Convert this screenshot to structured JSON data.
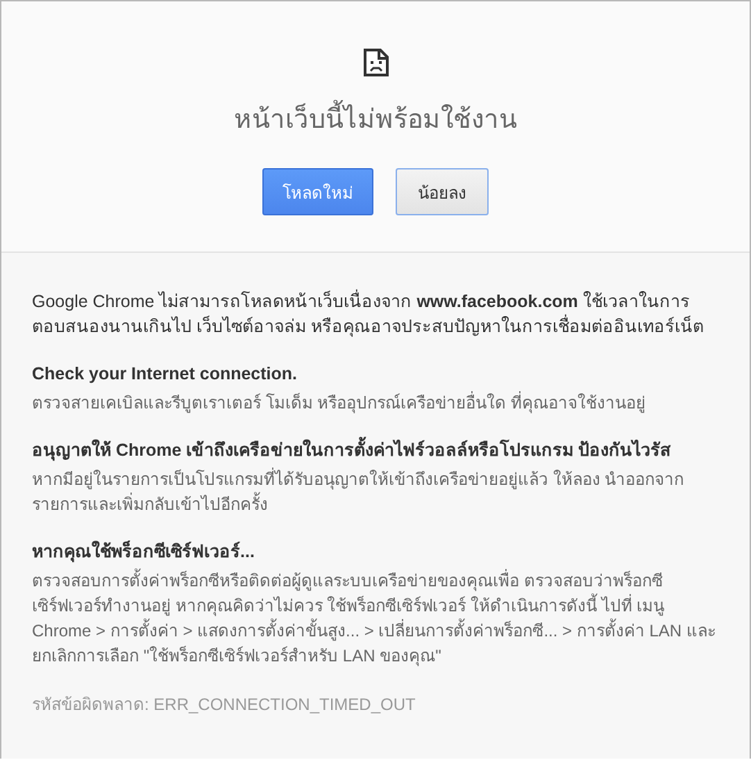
{
  "title": "หน้าเว็บนี้ไม่พร้อมใช้งาน",
  "buttons": [
    {
      "label": "โหลดใหม่",
      "kind": "primary"
    },
    {
      "label": "น้อยลง",
      "kind": "secondary"
    }
  ],
  "summary": "Google Chrome ไม่สามารถโหลดหน้าเว็บเนื่องจาก **www.facebook.com** ใช้เวลาในการตอบสนองนานเกินไป เว็บไซต์อาจล่ม หรือคุณอาจประสบปัญหาในการเชื่อมต่ออินเทอร์เน็ต",
  "suggestions": [
    {
      "heading": "Check your Internet connection.",
      "body": "ตรวจสายเคเบิลและรีบูตเราเตอร์ โมเด็ม หรืออุปกรณ์เครือข่ายอื่นใด ที่คุณอาจใช้งานอยู่"
    },
    {
      "heading": "อนุญาตให้ Chrome เข้าถึงเครือข่ายในการตั้งค่าไฟร์วอลล์หรือโปรแกรม ป้องกันไวรัส",
      "body": "หากมีอยู่ในรายการเป็นโปรแกรมที่ได้รับอนุญาตให้เข้าถึงเครือข่ายอยู่แล้ว ให้ลอง นำออกจากรายการและเพิ่มกลับเข้าไปอีกครั้ง"
    },
    {
      "heading": "หากคุณใช้พร็อกซีเซิร์ฟเวอร์...",
      "body": "ตรวจสอบการตั้งค่าพร็อกซีหรือติดต่อผู้ดูแลระบบเครือข่ายของคุณเพื่อ ตรวจสอบว่าพร็อกซีเซิร์ฟเวอร์ทำงานอยู่ หากคุณคิดว่าไม่ควร ใช้พร็อกซีเซิร์ฟเวอร์ ให้ดำเนินการดังนี้ ไปที่ เมนู Chrome > การตั้งค่า > แสดงการตั้งค่าขั้นสูง... > เปลี่ยนการตั้งค่าพร็อกซี... > การตั้งค่า LAN และยกเลิกการเลือก \"ใช้พร็อกซีเซิร์ฟเวอร์สำหรับ LAN ของคุณ\""
    }
  ],
  "error_code": "รหัสข้อผิดพลาด: ERR_CONNECTION_TIMED_OUT"
}
